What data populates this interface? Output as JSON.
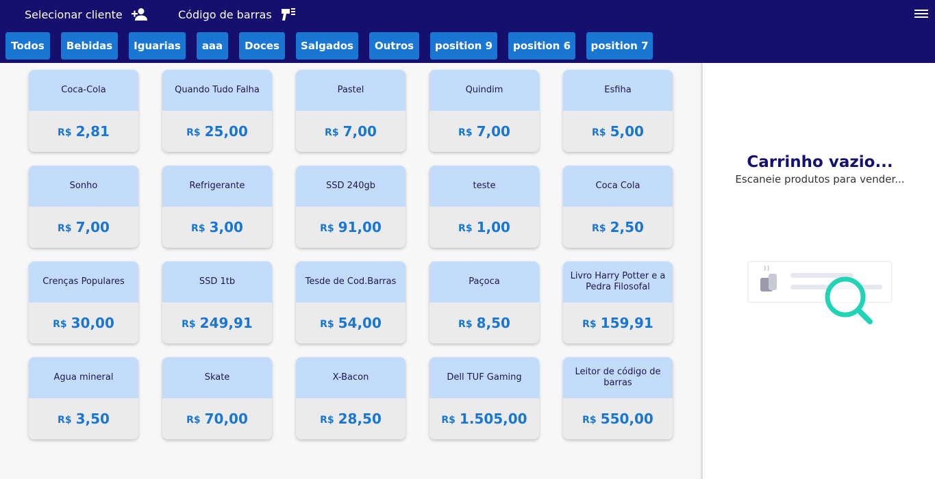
{
  "header": {
    "select_client": "Selecionar cliente",
    "barcode": "Código de barras"
  },
  "categories": [
    "Todos",
    "Bebidas",
    "Iguarias",
    "aaa",
    "Doces",
    "Salgados",
    "Outros",
    "position 9",
    "position 6",
    "position 7"
  ],
  "currency": "R$",
  "products": [
    {
      "name": "Coca-Cola",
      "price": "2,81"
    },
    {
      "name": "Quando Tudo Falha",
      "price": "25,00"
    },
    {
      "name": "Pastel",
      "price": "7,00"
    },
    {
      "name": "Quindim",
      "price": "7,00"
    },
    {
      "name": "Esfiha",
      "price": "5,00"
    },
    {
      "name": "Sonho",
      "price": "7,00"
    },
    {
      "name": "Refrigerante",
      "price": "3,00"
    },
    {
      "name": "SSD 240gb",
      "price": "91,00"
    },
    {
      "name": "teste",
      "price": "1,00"
    },
    {
      "name": "Coca Cola",
      "price": "2,50"
    },
    {
      "name": "Crenças Populares",
      "price": "30,00"
    },
    {
      "name": "SSD 1tb",
      "price": "249,91"
    },
    {
      "name": "Tesde de Cod.Barras",
      "price": "54,00"
    },
    {
      "name": "Paçoca",
      "price": "8,50"
    },
    {
      "name": "Livro Harry Potter e a Pedra Filosofal",
      "price": "159,91"
    },
    {
      "name": "Agua mineral",
      "price": "3,50"
    },
    {
      "name": "Skate",
      "price": "70,00"
    },
    {
      "name": "X-Bacon",
      "price": "28,50"
    },
    {
      "name": "Dell TUF Gaming",
      "price": "1.505,00"
    },
    {
      "name": "Leitor de código de barras",
      "price": "550,00"
    }
  ],
  "cart": {
    "empty_title": "Carrinho vazio...",
    "empty_subtitle": "Escaneie produtos para vender..."
  },
  "icons": {
    "client": "add-person-icon",
    "barcode": "barcode-scanner-icon",
    "menu": "hamburger-menu-icon",
    "empty_cart": "empty-search-illustration"
  },
  "colors": {
    "header_bg": "#150f6e",
    "accent": "#1976d2",
    "card_name_bg": "#c4dcfb",
    "card_price_bg": "#ebebeb",
    "search_accent": "#22d4b6"
  }
}
